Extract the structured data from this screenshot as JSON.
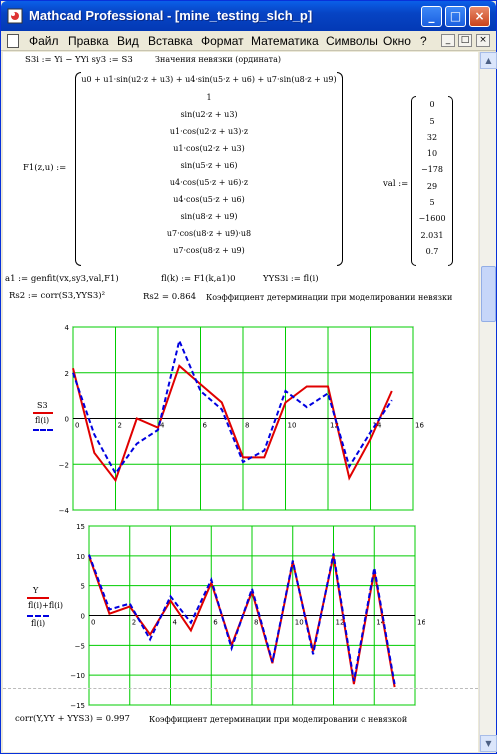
{
  "window": {
    "title": "Mathcad Professional - [mine_testing_slch_p]",
    "buttons": [
      "_",
      "□",
      "×"
    ]
  },
  "menubar": {
    "items": [
      "Файл",
      "Правка",
      "Вид",
      "Вставка",
      "Формат",
      "Математика",
      "Символы",
      "Окно",
      "?"
    ],
    "mdi_buttons": [
      "_",
      "□",
      "×"
    ]
  },
  "worksheet": {
    "line1": "S3i := Yi − YYi   sy3 := S3",
    "line1_comment": "Значения невязки (ордината)",
    "f1_label": "F1(z,u) :=",
    "f1_rows": [
      "u0 + u1·sin(u2·z + u3) + u4·sin(u5·z + u6) + u7·sin(u8·z + u9)",
      "1",
      "sin(u2·z + u3)",
      "u1·cos(u2·z + u3)·z",
      "u1·cos(u2·z + u3)",
      "sin(u5·z + u6)",
      "u4·cos(u5·z + u6)·z",
      "u4·cos(u5·z + u6)",
      "sin(u8·z + u9)",
      "u7·cos(u8·z + u9)·u8",
      "u7·cos(u8·z + u9)"
    ],
    "val_label": "val :=",
    "val_values": [
      "0",
      "5",
      "32",
      "10",
      "−178",
      "29",
      "5",
      "−1600",
      "2.031",
      "0.7"
    ],
    "genfit_line": "a1 := genfit(vx,sy3,val,F1)",
    "fl_def": "fl(k) := F1(k,a1)0",
    "yys3_def": "YYS3i := fl(i)",
    "rs2_def": "Rs2 := corr(S3,YYS3)²",
    "rs2_value": "Rs2 = 0.864",
    "rs2_comment": "Коэффициент детерминации при  моделировании невязки",
    "final_corr": "corr(Y,YY + YYS3) = 0.997",
    "final_comment": "Коэффициент детерминации при моделировании с невязкой"
  },
  "chart_data": [
    {
      "type": "line",
      "legend": [
        "S3",
        "fl(i)"
      ],
      "ylim": [
        -4,
        4
      ],
      "xlim": [
        0,
        16
      ],
      "yticks": [
        "4",
        "2",
        "0",
        "−2",
        "−4"
      ],
      "xticks": [
        "0",
        "2",
        "4",
        "6",
        "8",
        "10",
        "12",
        "14",
        "16"
      ],
      "series": [
        {
          "name": "S3",
          "color": "#e00000",
          "style": "solid",
          "x": [
            0,
            1,
            2,
            3,
            4,
            5,
            6,
            7,
            8,
            9,
            10,
            11,
            12,
            13,
            14,
            15
          ],
          "values": [
            2.2,
            -1.5,
            -2.7,
            0.0,
            -0.4,
            2.3,
            1.5,
            0.7,
            -1.7,
            -1.7,
            0.7,
            1.4,
            1.4,
            -2.6,
            -0.9,
            1.2
          ]
        },
        {
          "name": "fl(i)",
          "color": "#0000e0",
          "style": "dash",
          "x": [
            0,
            1,
            2,
            3,
            4,
            5,
            6,
            7,
            8,
            9,
            10,
            11,
            12,
            13,
            14,
            15
          ],
          "values": [
            2.0,
            -0.7,
            -2.4,
            -1.1,
            -0.5,
            3.4,
            1.2,
            0.4,
            -1.9,
            -1.4,
            1.2,
            0.5,
            1.1,
            -2.1,
            -0.6,
            0.8
          ]
        }
      ]
    },
    {
      "type": "line",
      "legend": [
        "Y",
        "fl(i)+fl(i)",
        "fl(i)"
      ],
      "ylim": [
        -15,
        15
      ],
      "xlim": [
        0,
        16
      ],
      "yticks": [
        "15",
        "10",
        "5",
        "0",
        "−5",
        "−10",
        "−15"
      ],
      "xticks": [
        "0",
        "2",
        "4",
        "6",
        "8",
        "10",
        "12",
        "14",
        "16"
      ],
      "series": [
        {
          "name": "Y",
          "color": "#e00000",
          "style": "solid",
          "x": [
            0,
            1,
            2,
            3,
            4,
            5,
            6,
            7,
            8,
            9,
            10,
            11,
            12,
            13,
            14,
            15,
            16
          ],
          "values": [
            10,
            0.3,
            1.5,
            -3.2,
            2.5,
            -2.5,
            5.5,
            -5,
            4,
            -8,
            9,
            -6,
            10,
            -11.5,
            7.5,
            -12,
            null
          ]
        },
        {
          "name": "fl(i)",
          "color": "#0000e0",
          "style": "dash",
          "x": [
            0,
            1,
            2,
            3,
            4,
            5,
            6,
            7,
            8,
            9,
            10,
            11,
            12,
            13,
            14,
            15,
            16
          ],
          "values": [
            10.2,
            1,
            2,
            -4,
            3.2,
            -1.2,
            6,
            -5.5,
            4.5,
            -7.8,
            9.2,
            -6.5,
            10.4,
            -11,
            8,
            -11.5,
            null
          ]
        }
      ]
    }
  ]
}
